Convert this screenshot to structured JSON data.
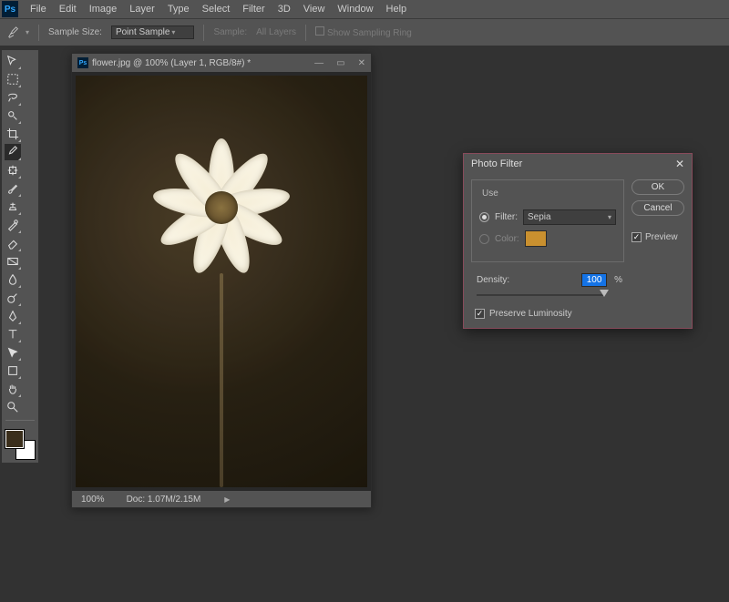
{
  "app": {
    "logo": "Ps"
  },
  "menu": {
    "items": [
      "File",
      "Edit",
      "Image",
      "Layer",
      "Type",
      "Select",
      "Filter",
      "3D",
      "View",
      "Window",
      "Help"
    ]
  },
  "options": {
    "sample_size_label": "Sample Size:",
    "sample_size_value": "Point Sample",
    "sample_label": "Sample:",
    "sample_value": "All Layers",
    "show_ring": "Show Sampling Ring"
  },
  "tools": {
    "names": [
      "move-tool",
      "marquee-tool",
      "lasso-tool",
      "quick-select-tool",
      "crop-tool",
      "eyedropper-tool",
      "spot-heal-tool",
      "brush-tool",
      "clone-stamp-tool",
      "history-brush-tool",
      "eraser-tool",
      "gradient-tool",
      "blur-tool",
      "dodge-tool",
      "pen-tool",
      "type-tool",
      "path-select-tool",
      "shape-tool",
      "hand-tool",
      "zoom-tool"
    ]
  },
  "swatches": {
    "fg": "#3a2e1b",
    "bg": "#ffffff"
  },
  "doc": {
    "title": "flower.jpg @ 100% (Layer 1, RGB/8#) *",
    "zoom": "100%",
    "size": "Doc: 1.07M/2.15M"
  },
  "dialog": {
    "title": "Photo Filter",
    "use_label": "Use",
    "filter_label": "Filter:",
    "filter_value": "Sepia",
    "color_label": "Color:",
    "color_value": "#c9902f",
    "density_label": "Density:",
    "density_value": "100",
    "density_unit": "%",
    "density_slider_pct": 100,
    "preserve_label": "Preserve Luminosity",
    "ok": "OK",
    "cancel": "Cancel",
    "preview": "Preview",
    "selected_radio": "filter",
    "preview_checked": true,
    "preserve_checked": true
  }
}
